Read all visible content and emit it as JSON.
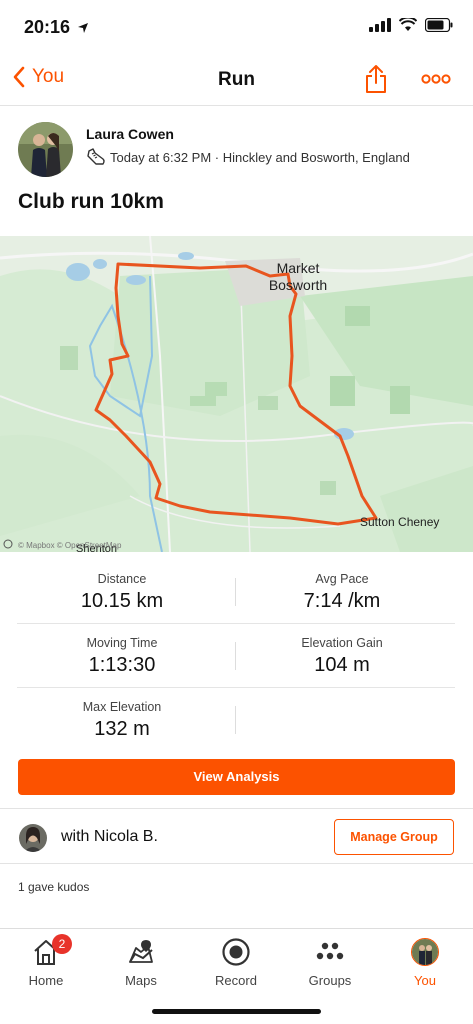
{
  "status_bar": {
    "time": "20:16"
  },
  "nav": {
    "back_label": "You",
    "title": "Run"
  },
  "athlete": {
    "name": "Laura Cowen",
    "meta": "Today at 6:32 PM · Hinckley and Bosworth, England"
  },
  "activity": {
    "title": "Club run 10km"
  },
  "map": {
    "places": [
      "Market",
      "Bosworth",
      "Sutton Cheney",
      "Shenton"
    ],
    "attribution": "© Mapbox © OpenStreetMap",
    "route_color": "#e8551f"
  },
  "stats": [
    {
      "label": "Distance",
      "value": "10.15 km"
    },
    {
      "label": "Avg Pace",
      "value": "7:14 /km"
    },
    {
      "label": "Moving Time",
      "value": "1:13:30"
    },
    {
      "label": "Elevation Gain",
      "value": "104 m"
    },
    {
      "label": "Max Elevation",
      "value": "132 m"
    }
  ],
  "actions": {
    "view_analysis": "View Analysis",
    "manage_group": "Manage Group"
  },
  "group": {
    "text": "with Nicola  B."
  },
  "kudos": {
    "text": "1 gave kudos"
  },
  "tabs": [
    {
      "label": "Home",
      "icon": "home-icon",
      "badge": "2"
    },
    {
      "label": "Maps",
      "icon": "maps-icon"
    },
    {
      "label": "Record",
      "icon": "record-icon"
    },
    {
      "label": "Groups",
      "icon": "groups-icon"
    },
    {
      "label": "You",
      "icon": "profile-avatar",
      "active": true
    }
  ],
  "colors": {
    "accent": "#fc5200",
    "badge": "#e8332a"
  }
}
